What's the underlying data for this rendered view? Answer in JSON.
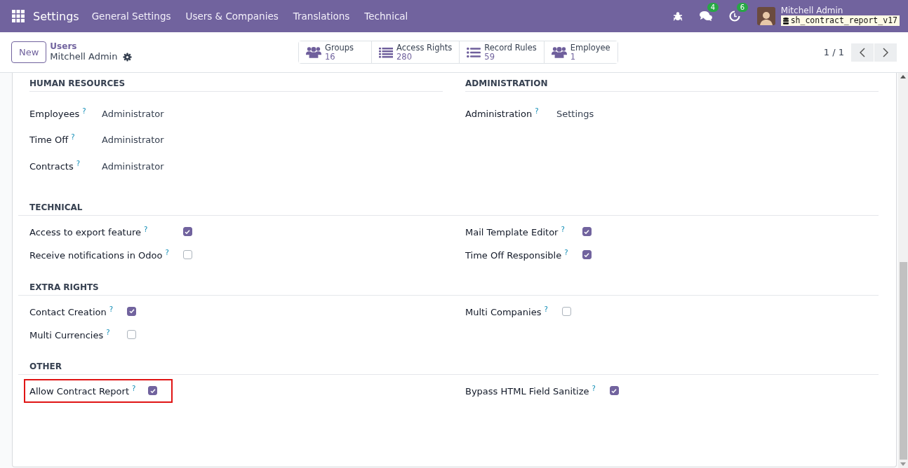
{
  "navbar": {
    "app": "Settings",
    "menu": [
      "General Settings",
      "Users & Companies",
      "Translations",
      "Technical"
    ],
    "systray": [
      {
        "kind": "bug"
      },
      {
        "kind": "chat",
        "badge": "4"
      },
      {
        "kind": "clock",
        "badge": "6"
      }
    ],
    "user": {
      "name": "Mitchell Admin",
      "database": "sh_contract_report_v17"
    }
  },
  "control_panel": {
    "new_button": "New",
    "breadcrumb": "Users",
    "record": "Mitchell Admin",
    "smart_buttons": [
      {
        "kind": "people",
        "label": "Groups",
        "count": "16"
      },
      {
        "kind": "list",
        "label": "Access Rights",
        "count": "280"
      },
      {
        "kind": "bullets",
        "label": "Record Rules",
        "count": "59"
      },
      {
        "kind": "people",
        "label": "Employee",
        "count": "1"
      }
    ],
    "pager": "1 / 1"
  },
  "top_groups": [
    {
      "title": "HUMAN RESOURCES",
      "fields": [
        {
          "label": "Employees",
          "help": "?",
          "value": "Administrator"
        },
        {
          "label": "Time Off",
          "help": "?",
          "value": "Administrator"
        },
        {
          "label": "Contracts",
          "help": "?",
          "value": "Administrator"
        }
      ]
    },
    {
      "title": "ADMINISTRATION",
      "fields": [
        {
          "label": "Administration",
          "help": "?",
          "value": "Settings"
        }
      ]
    }
  ],
  "sections": [
    {
      "title": "TECHNICAL",
      "left": [
        {
          "label": "Access to export feature",
          "help": "?",
          "checked": true,
          "highlighted": false
        },
        {
          "label": "Receive notifications in Odoo",
          "help": "?",
          "checked": false,
          "highlighted": false
        }
      ],
      "right": [
        {
          "label": "Mail Template Editor",
          "help": "?",
          "checked": true,
          "highlighted": false
        },
        {
          "label": "Time Off Responsible",
          "help": "?",
          "checked": true,
          "highlighted": false
        }
      ]
    },
    {
      "title": "EXTRA RIGHTS",
      "left": [
        {
          "label": "Contact Creation",
          "help": "?",
          "checked": true,
          "highlighted": false
        },
        {
          "label": "Multi Currencies",
          "help": "?",
          "checked": false,
          "highlighted": false
        }
      ],
      "right": [
        {
          "label": "Multi Companies",
          "help": "?",
          "checked": false,
          "highlighted": false
        }
      ]
    },
    {
      "title": "OTHER",
      "left": [
        {
          "label": "Allow Contract Report",
          "help": "?",
          "checked": true,
          "highlighted": true
        }
      ],
      "right": [
        {
          "label": "Bypass HTML Field Sanitize",
          "help": "?",
          "checked": true,
          "highlighted": false
        }
      ]
    }
  ]
}
